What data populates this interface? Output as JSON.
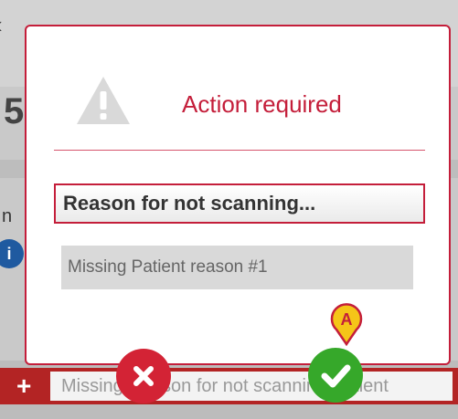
{
  "background": {
    "partial_digit": "5",
    "partial_letter": "n",
    "info_glyph": "i",
    "bottom_input_text": "Missing Reason for not scanning Patient",
    "add_glyph": "+"
  },
  "dialog": {
    "title": "Action required",
    "icon": "warning-triangle-icon",
    "reason_button_label": "Reason for not scanning...",
    "reason_option": "Missing Patient reason #1"
  },
  "actions": {
    "cancel_icon": "close-icon",
    "confirm_icon": "checkmark-icon"
  },
  "marker": {
    "label": "A"
  },
  "colors": {
    "accent_red": "#c41e3a",
    "cancel_red": "#d32335",
    "confirm_green": "#36a82a",
    "marker_yellow": "#f5c518"
  }
}
